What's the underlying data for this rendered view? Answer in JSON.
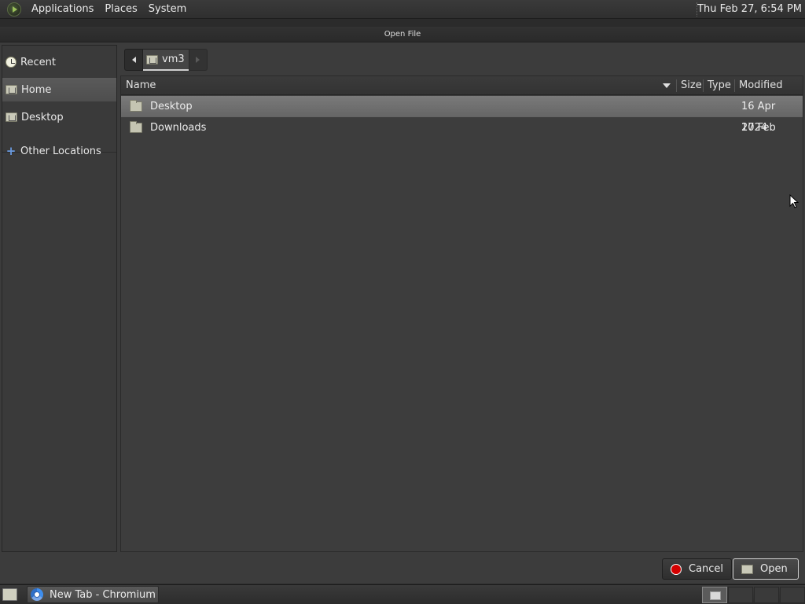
{
  "top_panel": {
    "menus": [
      "Applications",
      "Places",
      "System"
    ],
    "clock": "Thu Feb 27,  6:54 PM"
  },
  "dialog": {
    "title": "Open File",
    "sidebar": {
      "items": [
        {
          "label": "Recent",
          "icon": "clock-icon"
        },
        {
          "label": "Home",
          "icon": "home-folder-icon",
          "selected": true
        },
        {
          "label": "Desktop",
          "icon": "desktop-folder-icon"
        },
        {
          "label": "Other Locations",
          "icon": "plus-icon"
        }
      ]
    },
    "pathbar": {
      "crumbs": [
        {
          "label": "vm3",
          "icon": "home-folder-icon"
        }
      ]
    },
    "columns": {
      "name": "Name",
      "size": "Size",
      "type": "Type",
      "modified": "Modified"
    },
    "files": [
      {
        "name": "Desktop",
        "size": "",
        "type": "",
        "modified": "16 Apr 2024",
        "selected": true
      },
      {
        "name": "Downloads",
        "size": "",
        "type": "",
        "modified": "17 Feb",
        "selected": false
      }
    ],
    "buttons": {
      "cancel": "Cancel",
      "open": "Open"
    }
  },
  "taskbar": {
    "tasks": [
      {
        "label": "New Tab - Chromium",
        "icon": "chromium-icon"
      }
    ]
  }
}
